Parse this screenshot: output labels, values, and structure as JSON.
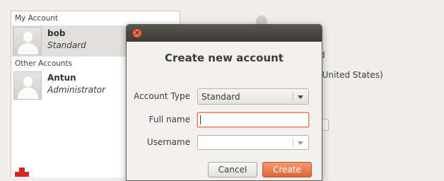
{
  "accounts": {
    "my_account_label": "My Account",
    "other_accounts_label": "Other Accounts",
    "current": {
      "name": "bob",
      "type": "Standard"
    },
    "others": [
      {
        "name": "Antun",
        "type": "Administrator"
      }
    ]
  },
  "background": {
    "text_d": "d",
    "text_region": "(United States)"
  },
  "dialog": {
    "title": "Create new account",
    "close_glyph": "×",
    "account_type_label": "Account Type",
    "account_type_value": "Standard",
    "full_name_label": "Full name",
    "full_name_value": "",
    "username_label": "Username",
    "username_value": "",
    "cancel_label": "Cancel",
    "create_label": "Create"
  },
  "colors": {
    "accent": "#e0663a",
    "delete_icon": "#d6281d",
    "titlebar": "#3c3b37"
  },
  "icons": [
    "user-avatar-icon",
    "close-icon",
    "chevron-down-icon",
    "remove-account-icon"
  ]
}
